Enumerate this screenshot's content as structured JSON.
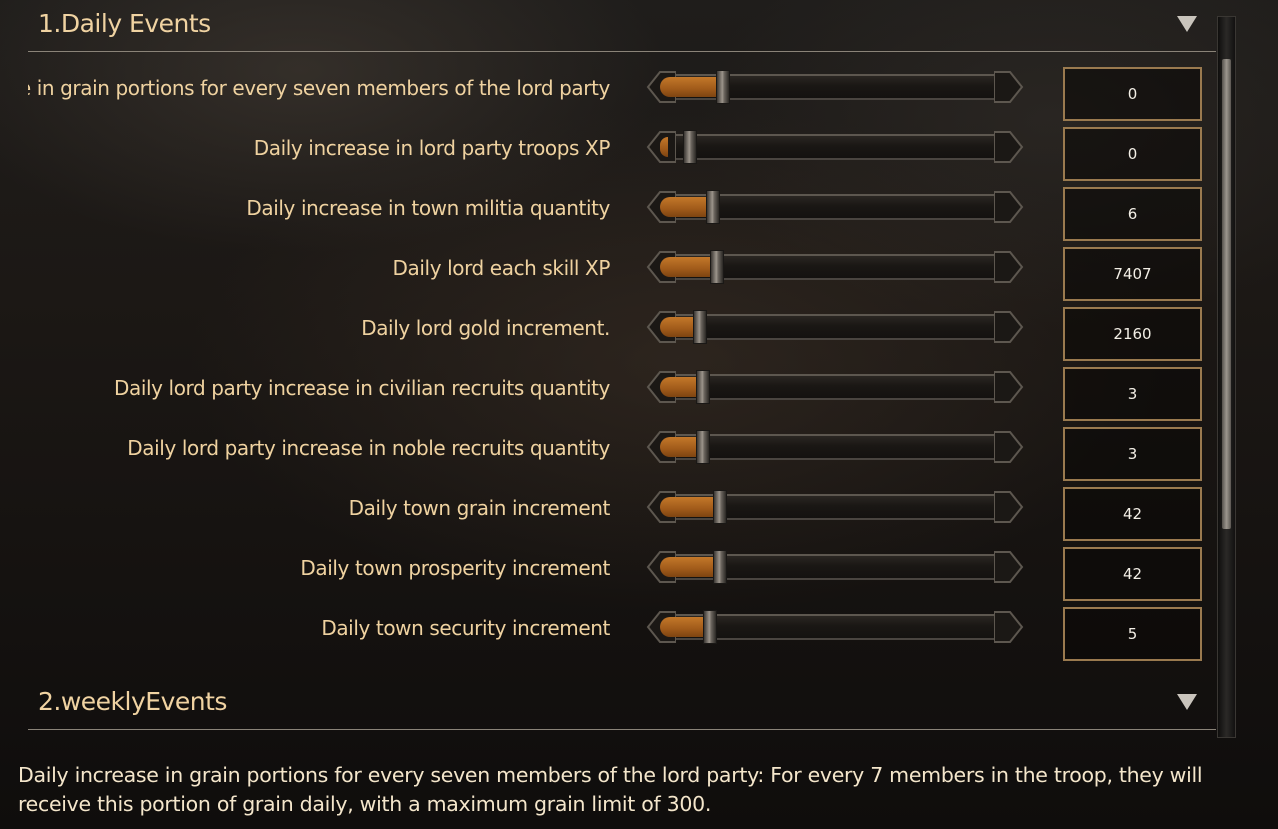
{
  "sections": [
    {
      "title": "1.Daily Events"
    },
    {
      "title": "2.weeklyEvents"
    }
  ],
  "rows": [
    {
      "label": "Daily increase in grain portions for every seven members of the lord party",
      "value": "0",
      "fill": 0.14
    },
    {
      "label": "Daily increase in lord party troops XP",
      "value": "0",
      "fill": 0.04
    },
    {
      "label": "Daily increase in town militia quantity",
      "value": "6",
      "fill": 0.11
    },
    {
      "label": "Daily lord each skill XP",
      "value": "7407",
      "fill": 0.12
    },
    {
      "label": "Daily lord gold increment.",
      "value": "2160",
      "fill": 0.07
    },
    {
      "label": "Daily lord party increase in civilian recruits quantity",
      "value": "3",
      "fill": 0.08
    },
    {
      "label": "Daily lord party increase in noble recruits quantity",
      "value": "3",
      "fill": 0.08
    },
    {
      "label": "Daily town grain increment",
      "value": "42",
      "fill": 0.13
    },
    {
      "label": "Daily town prosperity increment",
      "value": "42",
      "fill": 0.13
    },
    {
      "label": "Daily town security increment",
      "value": "5",
      "fill": 0.1
    }
  ],
  "description": "Daily increase in grain portions for every seven members of the lord party: For every 7 members in the troop, they will receive this portion of grain daily, with a maximum grain limit of 300.",
  "colors": {
    "accent": "#b8722a",
    "border": "#9a7a4f",
    "text": "#efd2a0"
  },
  "icons": {
    "collapse": "triangle-down"
  }
}
